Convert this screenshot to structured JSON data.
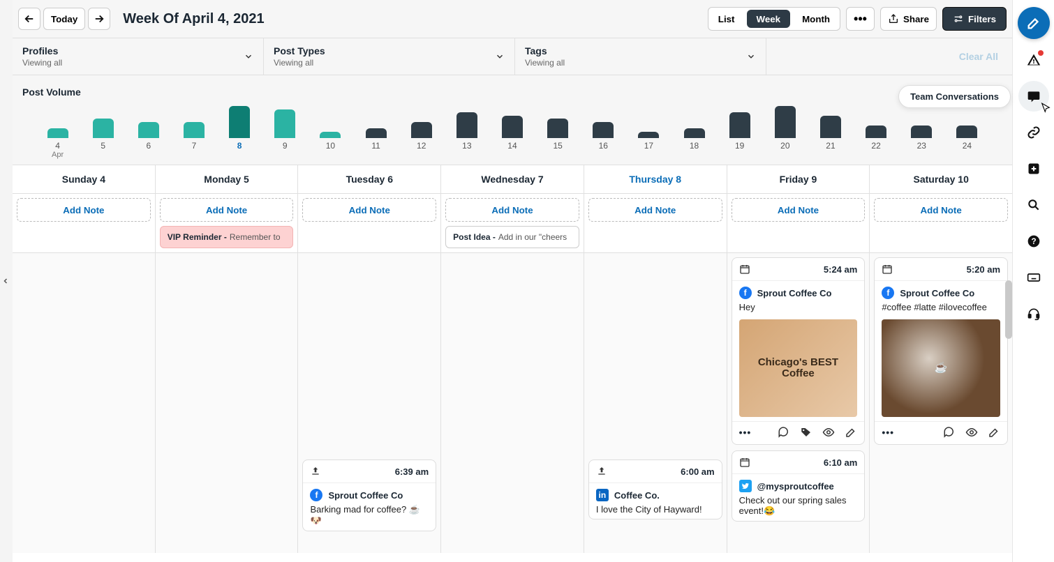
{
  "toolbar": {
    "today_label": "Today",
    "page_title": "Week Of April 4, 2021",
    "views": {
      "list": "List",
      "week": "Week",
      "month": "Month",
      "active": "week"
    },
    "share_label": "Share",
    "filters_label": "Filters"
  },
  "filters": {
    "profiles": {
      "title": "Profiles",
      "subtitle": "Viewing all"
    },
    "post_types": {
      "title": "Post Types",
      "subtitle": "Viewing all"
    },
    "tags": {
      "title": "Tags",
      "subtitle": "Viewing all"
    },
    "clear_all": "Clear All"
  },
  "volume": {
    "title": "Post Volume",
    "month_label": "Apr"
  },
  "chart_data": {
    "type": "bar",
    "categories": [
      "4",
      "5",
      "6",
      "7",
      "8",
      "9",
      "10",
      "11",
      "12",
      "13",
      "14",
      "15",
      "16",
      "17",
      "18",
      "19",
      "20",
      "21",
      "22",
      "23",
      "24"
    ],
    "values": [
      3,
      6,
      5,
      5,
      10,
      9,
      2,
      3,
      5,
      8,
      7,
      6,
      5,
      2,
      3,
      8,
      10,
      7,
      4,
      4,
      4
    ],
    "current_range_end_index": 6,
    "selected_index": 4,
    "ylim": [
      0,
      10
    ],
    "xlabel": "",
    "ylabel": ""
  },
  "days": [
    {
      "label": "Sunday 4",
      "today": false
    },
    {
      "label": "Monday 5",
      "today": false
    },
    {
      "label": "Tuesday 6",
      "today": false
    },
    {
      "label": "Wednesday 7",
      "today": false
    },
    {
      "label": "Thursday 8",
      "today": true
    },
    {
      "label": "Friday 9",
      "today": false
    },
    {
      "label": "Saturday 10",
      "today": false
    }
  ],
  "add_note_label": "Add Note",
  "notes": {
    "monday": {
      "title": "VIP Reminder - ",
      "sub": "Remember to"
    },
    "wednesday": {
      "title": "Post Idea - ",
      "sub": "Add in our \"cheers"
    }
  },
  "posts": {
    "friday_1": {
      "time": "5:24 am",
      "network": "facebook",
      "profile": "Sprout Coffee Co",
      "text": "Hey",
      "image_text": "Chicago's BEST Coffee"
    },
    "friday_2": {
      "time": "6:10 am",
      "network": "twitter",
      "profile": "@mysproutcoffee",
      "text": "Check out our spring sales event!😂"
    },
    "saturday_1": {
      "time": "5:20 am",
      "network": "facebook",
      "profile": "Sprout Coffee Co",
      "text": "#coffee #latte #ilovecoffee",
      "image_text": ""
    },
    "tuesday_1": {
      "time": "6:39 am",
      "network": "facebook",
      "profile": "Sprout Coffee Co",
      "text": "Barking mad for coffee? ☕🐶"
    },
    "thursday_1": {
      "time": "6:00 am",
      "network": "linkedin",
      "profile": "Coffee Co.",
      "text": "I love the City of Hayward!"
    }
  },
  "tooltip": "Team Conversations",
  "colors": {
    "accent": "#0b6db7",
    "teal": "#2bb3a3",
    "dark": "#2f3d47"
  }
}
